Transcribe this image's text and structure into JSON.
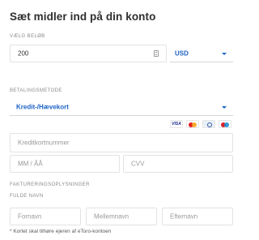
{
  "title": "Sæt midler ind på din konto",
  "amount": {
    "section_label": "VÆLG BELØB",
    "value": "200",
    "currency": "USD"
  },
  "payment": {
    "section_label": "BETALINGSMETODE",
    "method": "Kredit-/Hævekort",
    "card_brands": [
      "VISA",
      "MasterCard",
      "Diners Club",
      "Maestro"
    ]
  },
  "card": {
    "number_placeholder": "Kreditkortnummer",
    "expiry_placeholder": "MM / ÅÅ",
    "cvv_placeholder": "CVV"
  },
  "billing": {
    "section_label": "FAKTURERINGSOPLYSNINGER",
    "full_name_label": "FULDE NAVN",
    "first_name_placeholder": "Fornavn",
    "middle_name_placeholder": "Mellemnavn",
    "last_name_placeholder": "Efternavn"
  },
  "note": "* Kortet skal tilhøre ejeren af eToro-kontoen",
  "colors": {
    "accent": "#1d63c6",
    "border": "#e3e3e3"
  }
}
